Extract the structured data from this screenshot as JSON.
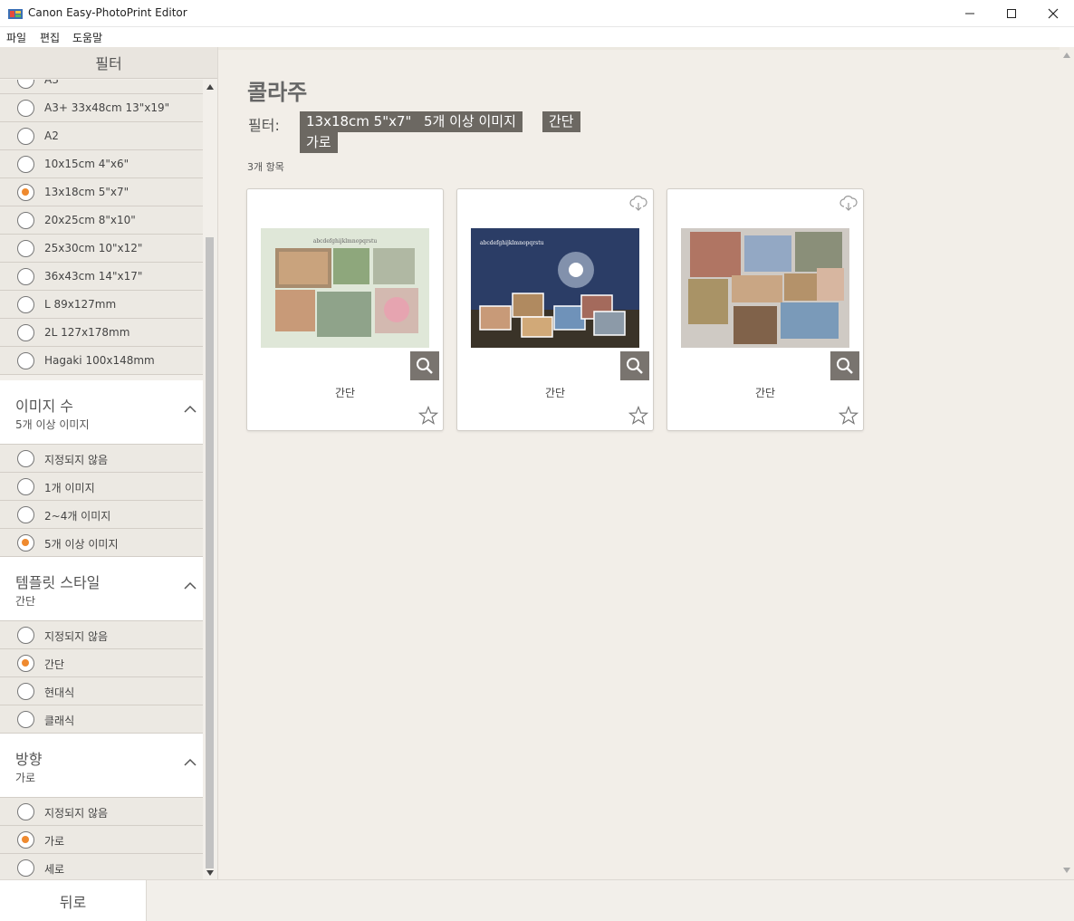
{
  "window": {
    "title": "Canon Easy-PhotoPrint Editor"
  },
  "menu": [
    "파일",
    "편집",
    "도움말"
  ],
  "sidebar": {
    "header": "필터",
    "sizes": [
      {
        "label": "A3",
        "selected": false
      },
      {
        "label": "A3+ 33x48cm 13\"x19\"",
        "selected": false
      },
      {
        "label": "A2",
        "selected": false
      },
      {
        "label": "10x15cm 4\"x6\"",
        "selected": false
      },
      {
        "label": "13x18cm 5\"x7\"",
        "selected": true
      },
      {
        "label": "20x25cm 8\"x10\"",
        "selected": false
      },
      {
        "label": "25x30cm 10\"x12\"",
        "selected": false
      },
      {
        "label": "36x43cm 14\"x17\"",
        "selected": false
      },
      {
        "label": "L 89x127mm",
        "selected": false
      },
      {
        "label": "2L 127x178mm",
        "selected": false
      },
      {
        "label": "Hagaki 100x148mm",
        "selected": false
      }
    ],
    "image_count": {
      "title": "이미지 수",
      "value": "5개 이상 이미지",
      "options": [
        {
          "label": "지정되지 않음",
          "selected": false
        },
        {
          "label": "1개 이미지",
          "selected": false
        },
        {
          "label": "2~4개 이미지",
          "selected": false
        },
        {
          "label": "5개 이상 이미지",
          "selected": true
        }
      ]
    },
    "template_style": {
      "title": "템플릿 스타일",
      "value": "간단",
      "options": [
        {
          "label": "지정되지 않음",
          "selected": false
        },
        {
          "label": "간단",
          "selected": true
        },
        {
          "label": "현대식",
          "selected": false
        },
        {
          "label": "클래식",
          "selected": false
        }
      ]
    },
    "orientation": {
      "title": "방향",
      "value": "가로",
      "options": [
        {
          "label": "지정되지 않음",
          "selected": false
        },
        {
          "label": "가로",
          "selected": true
        },
        {
          "label": "세로",
          "selected": false
        }
      ]
    }
  },
  "back_label": "뒤로",
  "main": {
    "title": "콜라주",
    "filter_label": "필터:",
    "chips": [
      "13x18cm 5\"x7\"",
      "5개 이상 이미지",
      "간단",
      "가로"
    ],
    "count": "3개 항목",
    "cards": [
      {
        "caption": "간단",
        "thumb_text": "abcdefghijklmnopqrstu",
        "download": false
      },
      {
        "caption": "간단",
        "thumb_text": "abcdefghijklmnopqrstu",
        "download": true
      },
      {
        "caption": "간단",
        "download": true
      }
    ]
  },
  "colors": {
    "accent": "#ef8a2f",
    "chip": "#6c6862",
    "background": "#f2eee8"
  }
}
